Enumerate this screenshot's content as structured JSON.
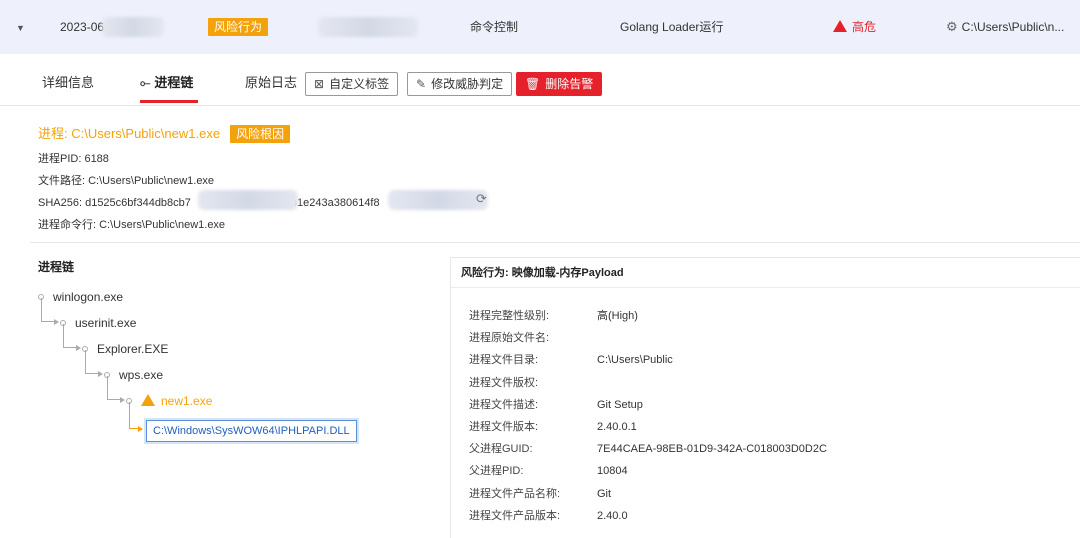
{
  "alert_row": {
    "date": "2023-06-",
    "behavior_badge": "风险行为",
    "category": "命令控制",
    "rule": "Golang Loader运行",
    "severity": "高危",
    "path": "C:\\Users\\Public\\n..."
  },
  "tabs": {
    "details": "详细信息",
    "chain": "进程链",
    "raw_log": "原始日志",
    "custom_tag": "自定义标签",
    "modify_verdict": "修改威胁判定",
    "delete_alert": "删除告警"
  },
  "process": {
    "title": "进程: C:\\Users\\Public\\new1.exe",
    "root_badge": "风险根因",
    "pid": "进程PID: 6188",
    "file_path": "文件路径: C:\\Users\\Public\\new1.exe",
    "sha_prefix": "SHA256: d1525c6bf344db8cb7",
    "sha_middle": "b1e243a380614f8",
    "cmdline": "进程命令行: C:\\Users\\Public\\new1.exe"
  },
  "chain": {
    "title": "进程链",
    "nodes": [
      "winlogon.exe",
      "userinit.exe",
      "Explorer.EXE",
      "wps.exe",
      "new1.exe"
    ],
    "dll": "C:\\Windows\\SysWOW64\\IPHLPAPI.DLL"
  },
  "detail": {
    "title": "风险行为: 映像加载-内存Payload",
    "rows": [
      {
        "k": "进程完整性级别:",
        "v": "高(High)"
      },
      {
        "k": "进程原始文件名:",
        "v": ""
      },
      {
        "k": "进程文件目录:",
        "v": "C:\\Users\\Public"
      },
      {
        "k": "进程文件版权:",
        "v": ""
      },
      {
        "k": "进程文件描述:",
        "v": "Git Setup"
      },
      {
        "k": "进程文件版本:",
        "v": "2.40.0.1"
      },
      {
        "k": "父进程GUID:",
        "v": "7E44CAEA-98EB-01D9-342A-C018003D0D2C"
      },
      {
        "k": "父进程PID:",
        "v": "10804"
      },
      {
        "k": "进程文件产品名称:",
        "v": "Git"
      },
      {
        "k": "进程文件产品版本:",
        "v": "2.40.0"
      }
    ]
  },
  "colors": {
    "accent_red": "#e5222b",
    "warning_orange": "#f3a20c",
    "link_blue": "#1f5fbf"
  }
}
